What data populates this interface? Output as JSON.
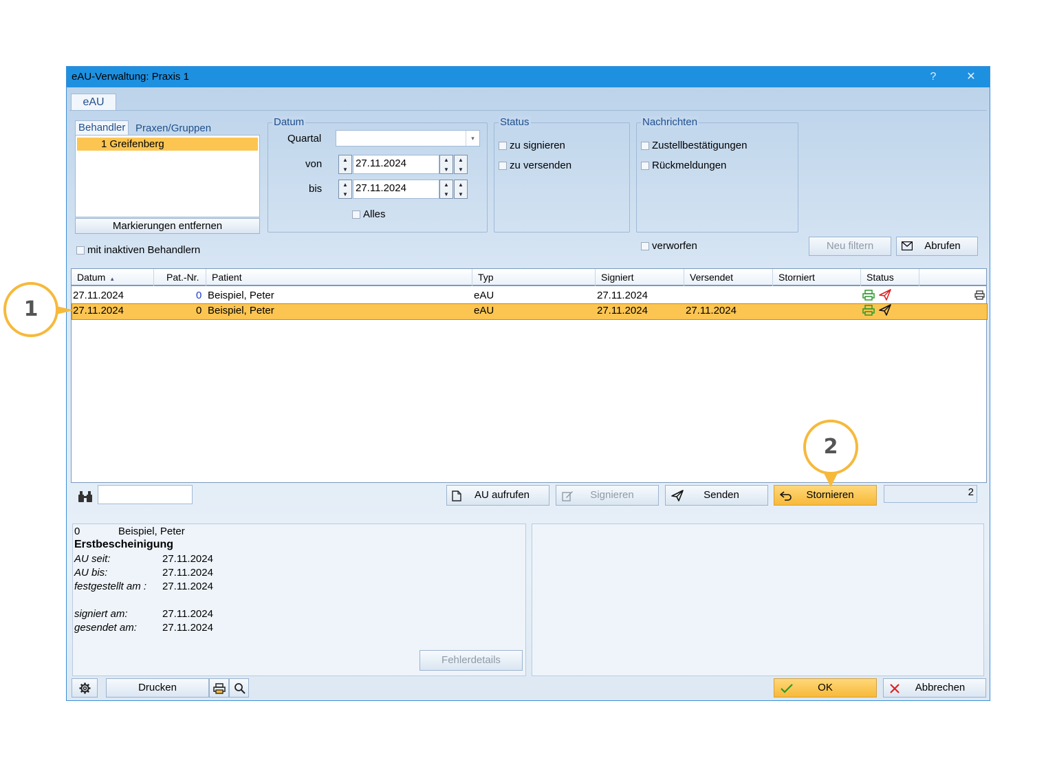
{
  "window": {
    "title": "eAU-Verwaltung: Praxis 1",
    "help": "?",
    "close": "✕"
  },
  "tabs": [
    "eAU"
  ],
  "behandler": {
    "tab_active": "Behandler",
    "tab_other": "Praxen/Gruppen",
    "items": [
      "1 Greifenberg"
    ],
    "clear_button": "Markierungen entfernen",
    "inactive_checkbox": "mit inaktiven Behandlern"
  },
  "datum": {
    "legend": "Datum",
    "quartal_label": "Quartal",
    "quartal_value": "",
    "von_label": "von",
    "von_value": "27.11.2024",
    "bis_label": "bis",
    "bis_value": "27.11.2024",
    "alles_label": "Alles"
  },
  "status_group": {
    "legend": "Status",
    "options": [
      "zu signieren",
      "zu versenden"
    ]
  },
  "nachrichten": {
    "legend": "Nachrichten",
    "options": [
      "Zustellbestätigungen",
      "Rückmeldungen"
    ],
    "verworfen": "verworfen"
  },
  "filter_button": "Neu filtern",
  "abrufen_button": "Abrufen",
  "table": {
    "columns": [
      "Datum",
      "Pat.-Nr.",
      "Patient",
      "Typ",
      "Signiert",
      "Versendet",
      "Storniert",
      "Status"
    ],
    "rows": [
      {
        "datum": "27.11.2024",
        "patnr": "0",
        "patient": "Beispiel, Peter",
        "typ": "eAU",
        "signiert": "27.11.2024",
        "versendet": "",
        "storniert": "",
        "selected": false
      },
      {
        "datum": "27.11.2024",
        "patnr": "0",
        "patient": "Beispiel, Peter",
        "typ": "eAU",
        "signiert": "27.11.2024",
        "versendet": "27.11.2024",
        "storniert": "",
        "selected": true
      }
    ]
  },
  "actions": {
    "search_value": "",
    "au_aufrufen": "AU aufrufen",
    "signieren": "Signieren",
    "senden": "Senden",
    "stornieren": "Stornieren",
    "count": "2"
  },
  "details": {
    "patnr": "0",
    "patient": "Beispiel, Peter",
    "heading": "Erstbescheinigung",
    "au_seit_label": "AU seit:",
    "au_seit": "27.11.2024",
    "au_bis_label": "AU bis:",
    "au_bis": "27.11.2024",
    "festgestellt_label": "festgestellt am :",
    "festgestellt": "27.11.2024",
    "signiert_label": "signiert am:",
    "signiert": "27.11.2024",
    "gesendet_label": "gesendet am:",
    "gesendet": "27.11.2024",
    "fehlerdetails": "Fehlerdetails"
  },
  "footer": {
    "drucken": "Drucken",
    "ok": "OK",
    "abbrechen": "Abbrechen"
  },
  "callouts": [
    "1",
    "2"
  ],
  "colors": {
    "titlebar": "#1e90e0",
    "selection": "#fcc552",
    "callout": "#f6b93b",
    "print_icon": "#2a9a2a",
    "send_icon_red": "#e02020"
  }
}
